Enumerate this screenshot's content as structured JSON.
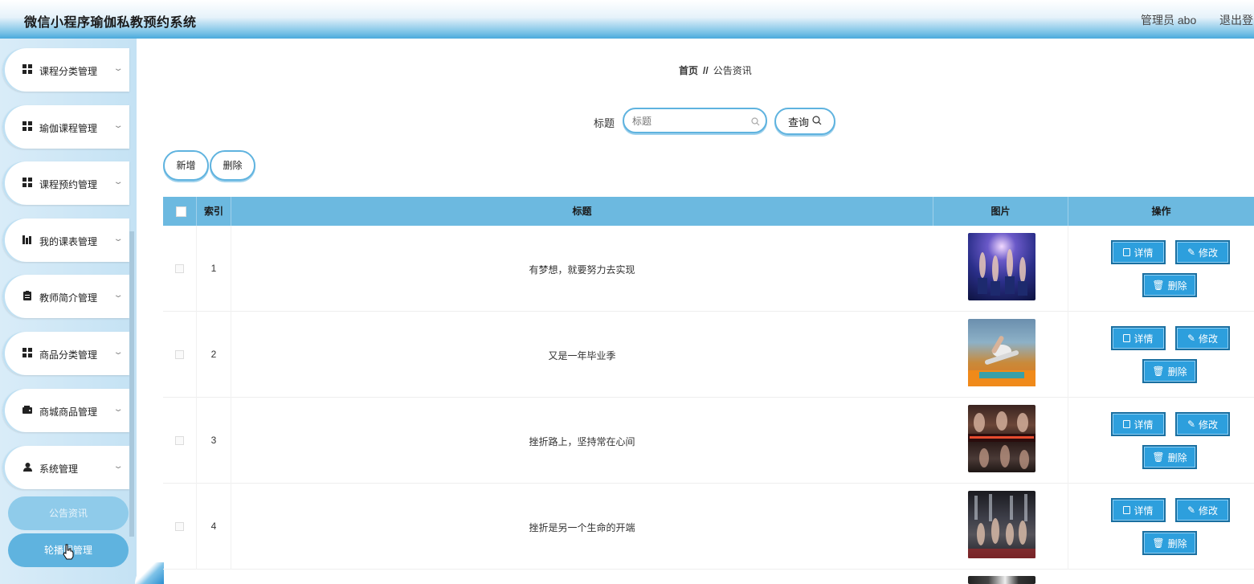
{
  "header": {
    "app_title": "微信小程序瑜伽私教预约系统",
    "admin_label": "管理员 abo",
    "logout_label": "退出登"
  },
  "sidebar": {
    "items": [
      {
        "label": "课程分类管理",
        "icon": "grid-icon"
      },
      {
        "label": "瑜伽课程管理",
        "icon": "grid-icon"
      },
      {
        "label": "课程预约管理",
        "icon": "grid-icon"
      },
      {
        "label": "我的课表管理",
        "icon": "bar-chart-icon"
      },
      {
        "label": "教师简介管理",
        "icon": "clipboard-icon"
      },
      {
        "label": "商品分类管理",
        "icon": "grid-icon"
      },
      {
        "label": "商城商品管理",
        "icon": "wallet-icon"
      },
      {
        "label": "系统管理",
        "icon": "user-icon"
      }
    ],
    "sub_items": [
      {
        "label": "公告资讯"
      },
      {
        "label": "轮播图管理"
      }
    ]
  },
  "breadcrumb": {
    "home": "首页",
    "separator": "//",
    "current": "公告资讯"
  },
  "search": {
    "label": "标题",
    "placeholder": "标题",
    "button_label": "查询"
  },
  "toolbar": {
    "add_label": "新增",
    "delete_label": "删除"
  },
  "table": {
    "columns": [
      "索引",
      "标题",
      "图片",
      "操作"
    ],
    "rows": [
      {
        "index": "1",
        "title": "有梦想，就要努力去实现"
      },
      {
        "index": "2",
        "title": "又是一年毕业季"
      },
      {
        "index": "3",
        "title": "挫折路上，坚持常在心间"
      },
      {
        "index": "4",
        "title": "挫折是另一个生命的开端"
      }
    ],
    "actions": {
      "detail": "详情",
      "edit": "修改",
      "delete": "删除"
    }
  },
  "colors": {
    "accent": "#5fb3df",
    "header_row": "#6cb9e0",
    "action_button": "#2d9fdd",
    "sidebar_bg": "#c4e2f4"
  }
}
